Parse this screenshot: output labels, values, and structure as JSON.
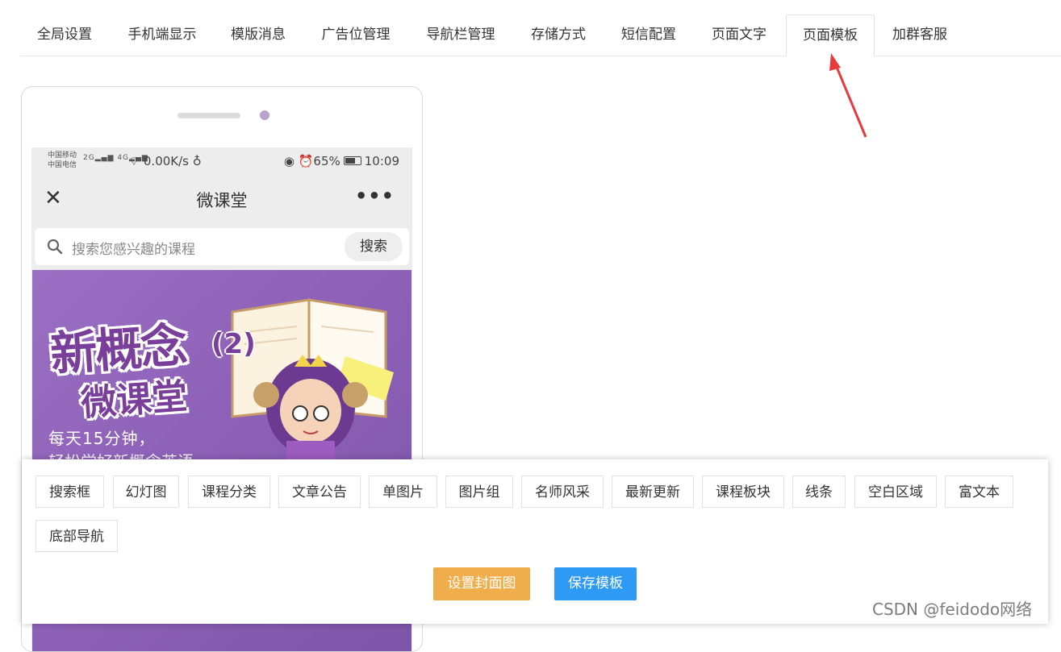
{
  "tabs": [
    {
      "label": "全局设置"
    },
    {
      "label": "手机端显示"
    },
    {
      "label": "模版消息"
    },
    {
      "label": "广告位管理"
    },
    {
      "label": "导航栏管理"
    },
    {
      "label": "存储方式"
    },
    {
      "label": "短信配置"
    },
    {
      "label": "页面文字"
    },
    {
      "label": "页面模板"
    },
    {
      "label": "加群客服"
    }
  ],
  "active_tab": "页面模板",
  "phone": {
    "status": {
      "carrier1": "中国移动",
      "carrier2": "中国电信",
      "net1": "2G",
      "net2": "4G",
      "speed": "0.00K/s",
      "battery": "65%",
      "time": "10:09"
    },
    "nav_title": "微课堂",
    "search": {
      "placeholder": "搜索您感兴趣的课程",
      "button": "搜索"
    },
    "banner": {
      "title": "新概念",
      "number": "(2)",
      "subtitle": "微课堂",
      "line1": "每天15分钟，",
      "line2": "轻松学好新概念英语"
    }
  },
  "components": [
    {
      "label": "搜索框"
    },
    {
      "label": "幻灯图"
    },
    {
      "label": "课程分类"
    },
    {
      "label": "文章公告"
    },
    {
      "label": "单图片"
    },
    {
      "label": "图片组"
    },
    {
      "label": "名师风采"
    },
    {
      "label": "最新更新"
    },
    {
      "label": "课程板块"
    },
    {
      "label": "线条"
    },
    {
      "label": "空白区域"
    },
    {
      "label": "富文本"
    },
    {
      "label": "底部导航"
    }
  ],
  "buttons": {
    "set_cover": "设置封面图",
    "save_template": "保存模板"
  },
  "watermark": "CSDN @feidodo网络",
  "colors": {
    "cover_button": "#efad4b",
    "save_button": "#2f9af5",
    "annotation_arrow": "#e8393b",
    "banner_bg": "#9a6fc2"
  }
}
